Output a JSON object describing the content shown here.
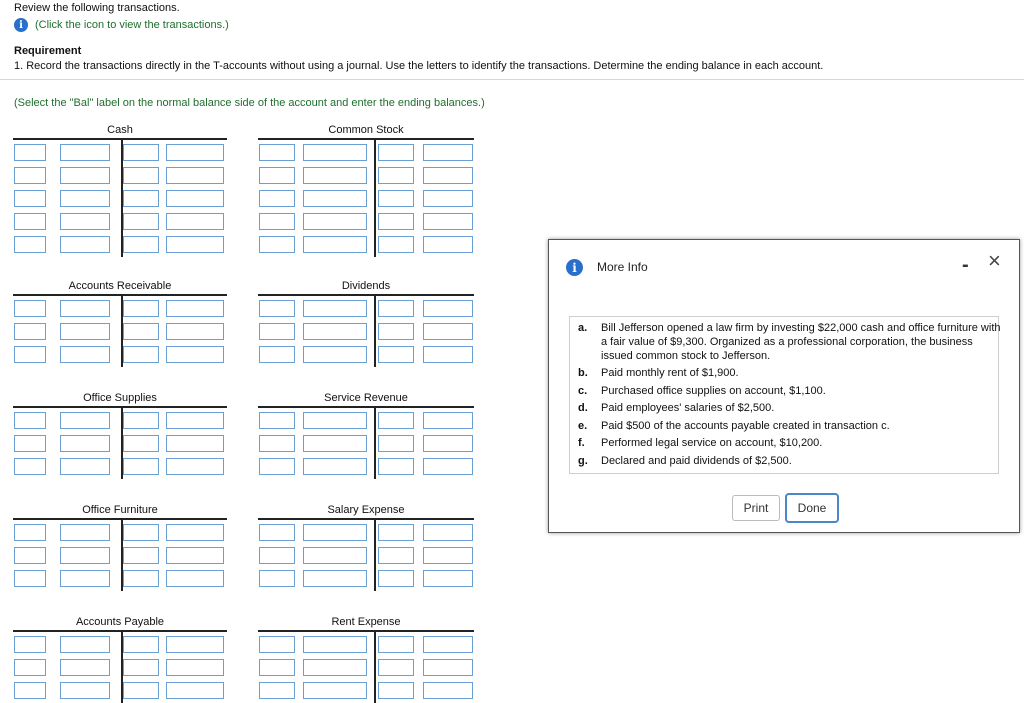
{
  "header": {
    "intro": "Review the following transactions.",
    "click_text": "(Click the icon to view the transactions.)",
    "requirement_title": "Requirement",
    "requirement_text": "1. Record the transactions directly in the T-accounts without using a journal. Use the letters to identify the transactions. Determine the ending balance in each account.",
    "select_note": "(Select the \"Bal\" label on the normal balance side of the account and enter the ending balances.)"
  },
  "accounts": [
    {
      "name": "Cash"
    },
    {
      "name": "Common Stock"
    },
    {
      "name": "Accounts Receivable"
    },
    {
      "name": "Dividends"
    },
    {
      "name": "Office Supplies"
    },
    {
      "name": "Service Revenue"
    },
    {
      "name": "Office Furniture"
    },
    {
      "name": "Salary Expense"
    },
    {
      "name": "Accounts Payable"
    },
    {
      "name": "Rent Expense"
    }
  ],
  "modal": {
    "title": "More Info",
    "info_icon": "i",
    "minimize": "-",
    "close": "×",
    "items": [
      {
        "letter": "a.",
        "text": "Bill Jefferson opened a law firm by investing $22,000 cash and office furniture with a fair value of $9,300. Organized as a professional corporation, the business issued common stock to Jefferson."
      },
      {
        "letter": "b.",
        "text": "Paid monthly rent of $1,900."
      },
      {
        "letter": "c.",
        "text": "Purchased office supplies on account, $1,100."
      },
      {
        "letter": "d.",
        "text": "Paid employees' salaries of $2,500."
      },
      {
        "letter": "e.",
        "text": "Paid $500 of the accounts payable created in transaction c."
      },
      {
        "letter": "f.",
        "text": "Performed legal service on account, $10,200."
      },
      {
        "letter": "g.",
        "text": "Declared and paid dividends of $2,500."
      }
    ],
    "print_label": "Print",
    "done_label": "Done"
  }
}
